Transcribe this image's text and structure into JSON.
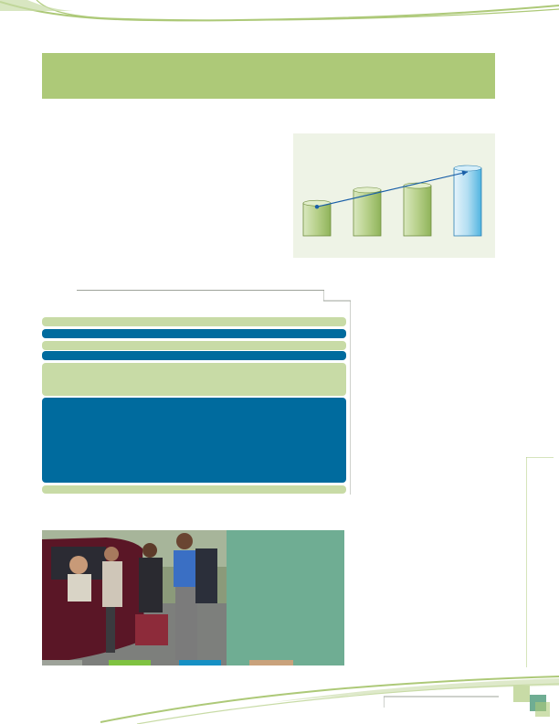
{
  "colors": {
    "light_green": "#adc978",
    "pale_green": "#c8dba6",
    "teal_blue": "#006b9e",
    "panel_bg": "#eef3e6",
    "sage": "#6fad93",
    "tan": "#c9a27c",
    "gray": "#9ea39a",
    "bright_green": "#7fc241",
    "blue": "#1790c4"
  },
  "chart_data": {
    "type": "bar",
    "categories": [
      "",
      "",
      "",
      ""
    ],
    "values": [
      30,
      42,
      46,
      62
    ],
    "ylim": [
      0,
      70
    ],
    "trend_line": true,
    "series": [
      {
        "values": [
          30,
          42,
          46,
          62
        ]
      }
    ]
  },
  "photo": {
    "icon": "business-people-car-photo"
  }
}
